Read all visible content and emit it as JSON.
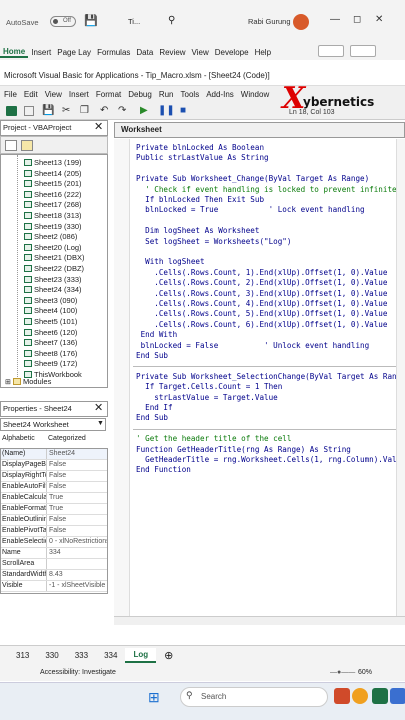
{
  "excel": {
    "autosave_label": "AutoSave",
    "autosave_state": "Off",
    "title_short": "Ti...",
    "user_name": "Rabi Gurung",
    "tabs": [
      "File",
      "Home",
      "Insert",
      "Page Lay",
      "Formulas",
      "Data",
      "Review",
      "View",
      "Develope",
      "Help"
    ],
    "active_tab": "Home",
    "sheet_tabs": [
      "313",
      "330",
      "333",
      "334",
      "Log"
    ],
    "active_sheet": "Log",
    "accessibility": "Accessibility: Investigate",
    "zoom": "60%"
  },
  "vba": {
    "window_title": "Microsoft Visual Basic for Applications - Tip_Macro.xlsm - [Sheet24 (Code)]",
    "menu": [
      "File",
      "Edit",
      "View",
      "Insert",
      "Format",
      "Debug",
      "Run",
      "Tools",
      "Add-Ins",
      "Window",
      "Help"
    ],
    "cursor_position": "Ln 18, Col 103",
    "logo_x": "X",
    "logo_text": "ybernetics",
    "project_title": "Project - VBAProject",
    "project_items": [
      "Sheet13 (199)",
      "Sheet14 (205)",
      "Sheet15 (201)",
      "Sheet16 (222)",
      "Sheet17 (268)",
      "Sheet18 (313)",
      "Sheet19 (330)",
      "Sheet2 (086)",
      "Sheet20 (Log)",
      "Sheet21 (DBX)",
      "Sheet22 (DBZ)",
      "Sheet23 (333)",
      "Sheet24 (334)",
      "Sheet3 (090)",
      "Sheet4 (100)",
      "Sheet5 (101)",
      "Sheet6 (120)",
      "Sheet7 (136)",
      "Sheet8 (176)",
      "Sheet9 (172)",
      "ThisWorkbook"
    ],
    "modules_label": "Modules",
    "properties_title": "Properties - Sheet24",
    "properties_object": "Sheet24  Worksheet",
    "properties_tabs": [
      "Alphabetic",
      "Categorized"
    ],
    "properties": [
      {
        "k": "(Name)",
        "v": "Sheet24"
      },
      {
        "k": "DisplayPageBreaks",
        "v": "False"
      },
      {
        "k": "DisplayRightToLeft",
        "v": "False"
      },
      {
        "k": "EnableAutoFilter",
        "v": "False"
      },
      {
        "k": "EnableCalculation",
        "v": "True"
      },
      {
        "k": "EnableFormatConditions",
        "v": "True"
      },
      {
        "k": "EnableOutlining",
        "v": "False"
      },
      {
        "k": "EnablePivotTable",
        "v": "False"
      },
      {
        "k": "EnableSelection",
        "v": "0 - xlNoRestrictions"
      },
      {
        "k": "Name",
        "v": "334"
      },
      {
        "k": "ScrollArea",
        "v": ""
      },
      {
        "k": "StandardWidth",
        "v": "8.43"
      },
      {
        "k": "Visible",
        "v": "-1 - xlSheetVisible"
      }
    ],
    "code_object": "Worksheet",
    "code_lines": [
      "Private blnLocked As Boolean",
      "Public strLastValue As String",
      "",
      "Private Sub Worksheet_Change(ByVal Target As Range)",
      "  ' Check if event handling is locked to prevent infinite loops",
      "  If blnLocked Then Exit Sub",
      "  blnLocked = True           ' Lock event handling",
      "",
      "  Dim logSheet As Worksheet",
      "  Set logSheet = Worksheets(\"Log\")",
      "",
      "  With logSheet",
      "    .Cells(.Rows.Count, 1).End(xlUp).Offset(1, 0).Value",
      "    .Cells(.Rows.Count, 2).End(xlUp).Offset(1, 0).Value",
      "    .Cells(.Rows.Count, 3).End(xlUp).Offset(1, 0).Value",
      "    .Cells(.Rows.Count, 4).End(xlUp).Offset(1, 0).Value",
      "    .Cells(.Rows.Count, 5).End(xlUp).Offset(1, 0).Value",
      "    .Cells(.Rows.Count, 6).End(xlUp).Offset(1, 0).Value",
      " End With",
      " blnLocked = False          ' Unlock event handling",
      "End Sub",
      "",
      "Private Sub Worksheet_SelectionChange(ByVal Target As Range)",
      "  If Target.Cells.Count = 1 Then",
      "    strLastValue = Target.Value",
      "  End If",
      "End Sub",
      "",
      "' Get the header title of the cell",
      "Function GetHeaderTitle(rng As Range) As String",
      "  GetHeaderTitle = rng.Worksheet.Cells(1, rng.Column).Value",
      "End Function"
    ]
  },
  "taskbar": {
    "search_placeholder": "Search"
  }
}
